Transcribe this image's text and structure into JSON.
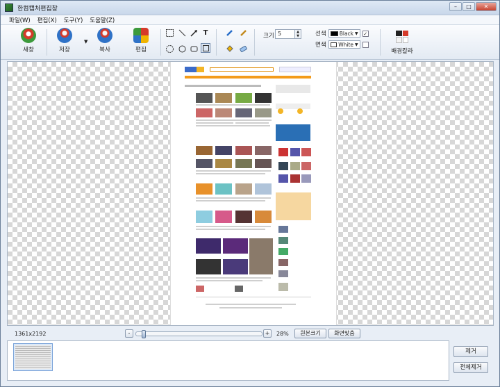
{
  "window": {
    "title": "한컴캡처편집창",
    "min": "–",
    "max": "□",
    "close": "✕"
  },
  "menu": [
    "파일(W)",
    "편집(X)",
    "도구(Y)",
    "도움말(Z)"
  ],
  "toolbar": {
    "new_window": "새창",
    "save": "저장",
    "copy": "복사",
    "edit": "편집",
    "size_label": "크기",
    "size_value": "5",
    "line_label": "선색",
    "line_color": "Black",
    "line_color_hex": "#000000",
    "fill_label": "면색",
    "fill_color": "White",
    "fill_color_hex": "#ffffff",
    "bg_color": "배경칼라",
    "check_mark": "✓"
  },
  "status": {
    "dimensions": "1361x2192",
    "zoom_minus": "-",
    "zoom_plus": "+",
    "zoom_percent": "28%",
    "zoom_value": 0.28,
    "original_size": "원본크기",
    "fit_screen": "화면맞춤"
  },
  "tray": {
    "remove": "제거",
    "remove_all": "전체제거"
  }
}
